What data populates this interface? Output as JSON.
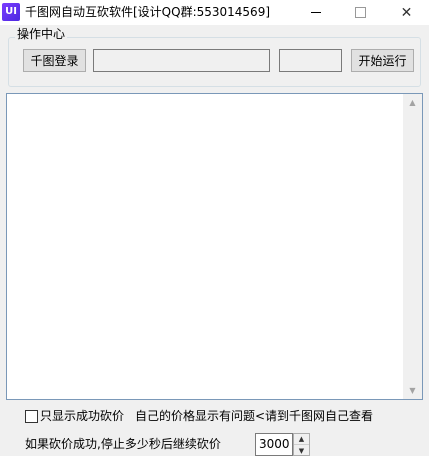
{
  "window": {
    "app_icon_text": "UI",
    "title": "千图网自动互砍软件[设计QQ群:553014569]",
    "minimize_glyph": "",
    "maximize_glyph": "",
    "close_glyph": "✕"
  },
  "group": {
    "label": "操作中心",
    "login_button": "千图登录",
    "field_a_value": "",
    "field_b_value": "",
    "start_button": "开始运行"
  },
  "log": {
    "content": "",
    "scroll_up_glyph": "▲",
    "scroll_down_glyph": "▼"
  },
  "options": {
    "checkbox_label": "只显示成功砍价",
    "checkbox_checked": false,
    "hint": "自己的价格显示有问题<请到千图网自己查看",
    "delay_label": "如果砍价成功,停止多少秒后继续砍价",
    "delay_value": "3000",
    "spin_up_glyph": "▲",
    "spin_down_glyph": "▼"
  }
}
